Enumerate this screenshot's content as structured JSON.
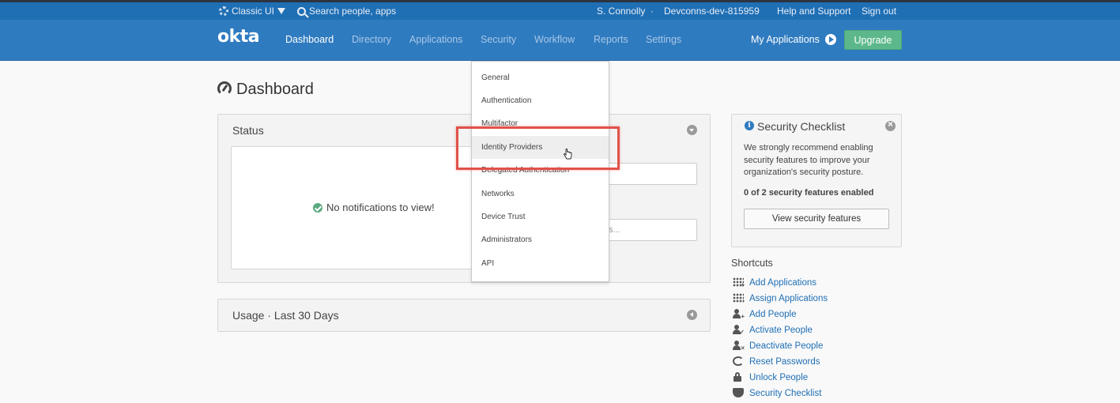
{
  "utility": {
    "classic_ui": "Classic UI",
    "search": "Search people, apps",
    "user": "S. Connolly",
    "separator": "·",
    "org": "Devconns-dev-815959",
    "help": "Help and Support",
    "signout": "Sign out"
  },
  "nav": {
    "logo": "okta",
    "items": [
      "Dashboard",
      "Directory",
      "Applications",
      "Security",
      "Workflow",
      "Reports",
      "Settings"
    ],
    "active": "Dashboard",
    "my_apps": "My Applications",
    "upgrade": "Upgrade"
  },
  "page": {
    "title": "Dashboard"
  },
  "status": {
    "title": "Status",
    "message": "No notifications to view!",
    "partial_placeholder": "s..."
  },
  "usage": {
    "title": "Usage · Last 30 Days"
  },
  "security_menu": {
    "items": [
      "General",
      "Authentication",
      "Multifactor",
      "Identity Providers",
      "Delegated Authentication",
      "Networks",
      "Device Trust",
      "Administrators",
      "API"
    ],
    "hovered": "Identity Providers"
  },
  "checklist": {
    "title": "Security Checklist",
    "body": "We strongly recommend enabling security features to improve your organization's security posture.",
    "status": "0 of 2 security features enabled",
    "button": "View security features"
  },
  "shortcuts": {
    "title": "Shortcuts",
    "items": [
      {
        "label": "Add Applications",
        "icon": "grid-plus-icon"
      },
      {
        "label": "Assign Applications",
        "icon": "grid-assign-icon"
      },
      {
        "label": "Add People",
        "icon": "person-add-icon"
      },
      {
        "label": "Activate People",
        "icon": "person-activate-icon"
      },
      {
        "label": "Deactivate People",
        "icon": "person-deactivate-icon"
      },
      {
        "label": "Reset Passwords",
        "icon": "refresh-icon"
      },
      {
        "label": "Unlock People",
        "icon": "lock-icon"
      },
      {
        "label": "Security Checklist",
        "icon": "shield-icon"
      }
    ]
  },
  "colors": {
    "nav_bg": "#2f7bc0",
    "util_bg": "#1f6fb5",
    "upgrade": "#5cb88b",
    "highlight": "#e0524a",
    "link": "#1f6fb5"
  }
}
